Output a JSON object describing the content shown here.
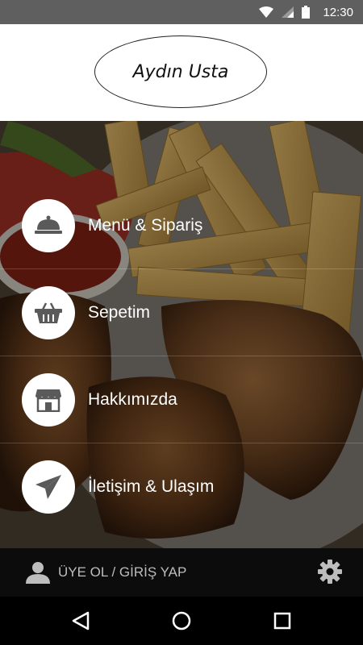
{
  "status_bar": {
    "time": "12:30",
    "icons": [
      "wifi-icon",
      "cell-signal-icon",
      "battery-icon"
    ]
  },
  "header": {
    "logo_text": "Aydın Usta"
  },
  "menu": {
    "items": [
      {
        "label": "Menü & Sipariş",
        "icon": "cloche-icon"
      },
      {
        "label": "Sepetim",
        "icon": "basket-icon"
      },
      {
        "label": "Hakkımızda",
        "icon": "storefront-icon"
      },
      {
        "label": "İletişim & Ulaşım",
        "icon": "paper-plane-icon"
      }
    ]
  },
  "bottom_bar": {
    "login_label": "ÜYE OL / GİRİŞ YAP",
    "icons": [
      "user-icon",
      "gear-icon"
    ]
  },
  "nav_bar": {
    "icons": [
      "back-icon",
      "home-icon",
      "recents-icon"
    ]
  },
  "colors": {
    "status_bar": "#5f5f5f",
    "header_bg": "#ffffff",
    "menu_icon": "#5a5a5a",
    "bottom_bar": "#0c0c0c",
    "nav_bar": "#000000"
  }
}
